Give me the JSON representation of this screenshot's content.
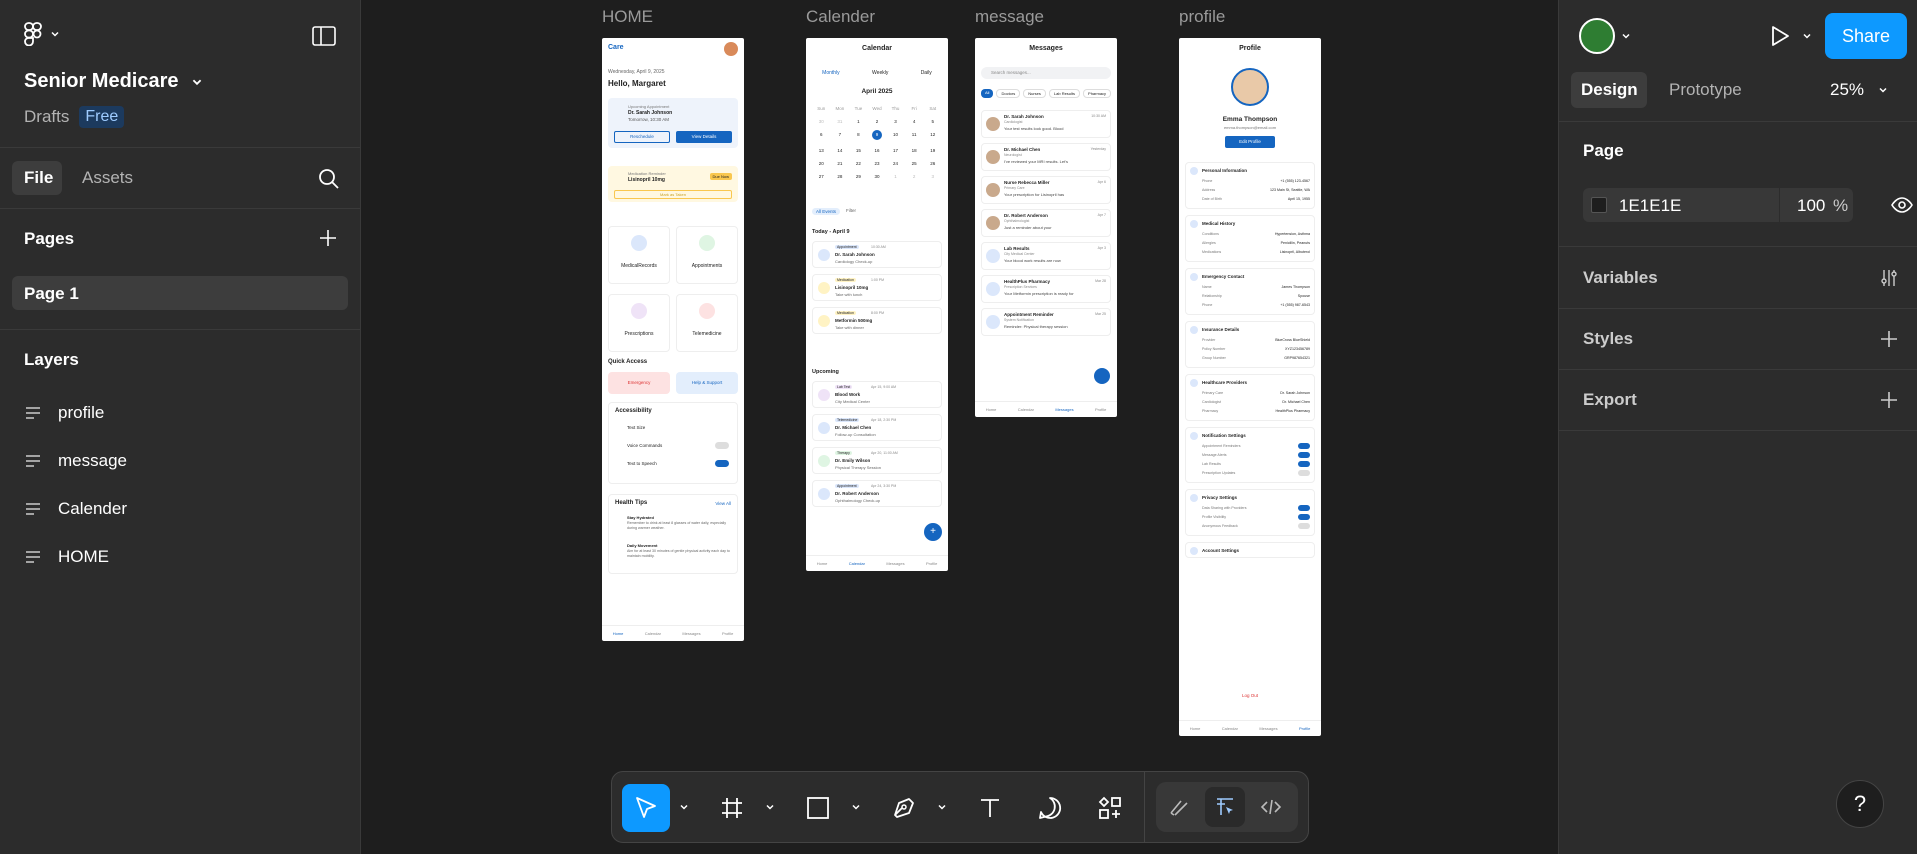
{
  "project": {
    "name": "Senior Medicare",
    "location": "Drafts",
    "plan": "Free"
  },
  "left_tabs": {
    "file": "File",
    "assets": "Assets"
  },
  "pages": {
    "title": "Pages",
    "items": [
      "Page 1"
    ]
  },
  "layers": {
    "title": "Layers",
    "items": [
      "profile",
      "message",
      "Calender",
      "HOME"
    ]
  },
  "frames": [
    {
      "label": "HOME"
    },
    {
      "label": "Calender"
    },
    {
      "label": "message"
    },
    {
      "label": "profile"
    }
  ],
  "home": {
    "logo": "Care",
    "date": "Wednesday, April 9, 2025",
    "greeting": "Hello, Margaret",
    "appt_label": "Upcoming Appointment",
    "appt_doctor": "Dr. Sarah Johnson",
    "appt_time": "Tomorrow, 10:30 AM",
    "reschedule": "Reschedule",
    "view_details": "View Details",
    "med_label": "Medication Reminder",
    "med_name": "Lisinopril 10mg",
    "due_now": "Due Now",
    "mark_taken": "Mark as Taken",
    "tiles": [
      "MedicalRecords",
      "Appointments",
      "Prescriptions",
      "Telemedicine"
    ],
    "quick_access": "Quick Access",
    "emergency": "Emergency",
    "help": "Help & Support",
    "accessibility": "Accessibility",
    "acc_items": [
      "Text Size",
      "Voice Commands",
      "Text to Speech"
    ],
    "health_tips": "Health Tips",
    "view_all": "View All",
    "tip1_title": "Stay Hydrated",
    "tip1_body": "Remember to drink at least 8 glasses of water daily, especially during warmer weather.",
    "tip2_title": "Daily Movement",
    "tip2_body": "Aim for at least 30 minutes of gentle physical activity each day to maintain mobility.",
    "nav": [
      "Home",
      "Calendar",
      "Messages",
      "Profile"
    ]
  },
  "calendar": {
    "title": "Calendar",
    "views": [
      "Monthly",
      "Weekly",
      "Daily"
    ],
    "month": "April 2025",
    "weekdays": [
      "Sun",
      "Mon",
      "Tue",
      "Wed",
      "Thu",
      "Fri",
      "Sat"
    ],
    "days": [
      "30",
      "31",
      "1",
      "2",
      "3",
      "4",
      "5",
      "6",
      "7",
      "8",
      "9",
      "10",
      "11",
      "12",
      "13",
      "14",
      "15",
      "16",
      "17",
      "18",
      "19",
      "20",
      "21",
      "22",
      "23",
      "24",
      "25",
      "26",
      "27",
      "28",
      "29",
      "30",
      "1",
      "2",
      "3"
    ],
    "filters": [
      "All Events",
      "Filter"
    ],
    "today": "Today - April 9",
    "today_items": [
      {
        "tag": "Appointment",
        "time": "10:30 AM",
        "title": "Dr. Sarah Johnson",
        "sub": "Cardiology Check-up"
      },
      {
        "tag": "Medication",
        "time": "1:00 PM",
        "title": "Lisinopril 10mg",
        "sub": "Take with lunch"
      },
      {
        "tag": "Medication",
        "time": "8:00 PM",
        "title": "Metformin 500mg",
        "sub": "Take with dinner"
      }
    ],
    "upcoming": "Upcoming",
    "upcoming_items": [
      {
        "tag": "Lab Test",
        "time": "Apr 15, 9:00 AM",
        "title": "Blood Work",
        "sub": "City Medical Center"
      },
      {
        "tag": "Telemedicine",
        "time": "Apr 18, 2:30 PM",
        "title": "Dr. Michael Chen",
        "sub": "Follow-up Consultation"
      },
      {
        "tag": "Therapy",
        "time": "Apr 20, 11:00 AM",
        "title": "Dr. Emily Wilson",
        "sub": "Physical Therapy Session"
      },
      {
        "tag": "Appointment",
        "time": "Apr 24, 3:30 PM",
        "title": "Dr. Robert Anderson",
        "sub": "Ophthalmology Check-up"
      }
    ],
    "nav": [
      "Home",
      "Calendar",
      "Messages",
      "Profile"
    ]
  },
  "messages": {
    "title": "Messages",
    "search": "Search messages...",
    "chips": [
      "All",
      "Doctors",
      "Nurses",
      "Lab Results",
      "Pharmacy"
    ],
    "items": [
      {
        "name": "Dr. Sarah Johnson",
        "role": "Cardiologist",
        "time": "10:30 AM",
        "text": "Your test results look good. Blood"
      },
      {
        "name": "Dr. Michael Chen",
        "role": "Neurologist",
        "time": "Yesterday",
        "text": "I've reviewed your MRI results. Let's"
      },
      {
        "name": "Nurse Rebecca Miller",
        "role": "Primary Care",
        "time": "Apr 6",
        "text": "Your prescription for Lisinopril has"
      },
      {
        "name": "Dr. Robert Anderson",
        "role": "Ophthalmologist",
        "time": "Apr 7",
        "text": "Just a reminder about your"
      },
      {
        "name": "Lab Results",
        "role": "City Medical Center",
        "time": "Apr 3",
        "text": "Your blood work results are now"
      },
      {
        "name": "HealthPlus Pharmacy",
        "role": "Prescription Services",
        "time": "Mar 28",
        "text": "Your Metformin prescription is ready for"
      },
      {
        "name": "Appointment Reminder",
        "role": "System Notification",
        "time": "Mar 25",
        "text": "Reminder: Physical therapy session"
      }
    ],
    "nav": [
      "Home",
      "Calendar",
      "Messages",
      "Profile"
    ]
  },
  "profile": {
    "title": "Profile",
    "name": "Emma Thompson",
    "email": "emma.thompson@email.com",
    "edit": "Edit Profile",
    "sections": [
      {
        "title": "Personal Information",
        "rows": [
          [
            "Phone",
            "+1 (555) 123-4567"
          ],
          [
            "Address",
            "123 Main St, Seattle, WA"
          ],
          [
            "Date of Birth",
            "April 15, 1955"
          ]
        ]
      },
      {
        "title": "Medical History",
        "rows": [
          [
            "Conditions",
            "Hypertension, Asthma"
          ],
          [
            "Allergies",
            "Penicillin, Peanuts"
          ],
          [
            "Medications",
            "Lisinopril, Albuterol"
          ]
        ]
      },
      {
        "title": "Emergency Contact",
        "rows": [
          [
            "Name",
            "James Thompson"
          ],
          [
            "Relationship",
            "Spouse"
          ],
          [
            "Phone",
            "+1 (555) 987-6543"
          ]
        ]
      },
      {
        "title": "Insurance Details",
        "rows": [
          [
            "Provider",
            "BlueCross BlueShield"
          ],
          [
            "Policy Number",
            "XYZ123456789"
          ],
          [
            "Group Number",
            "GRP987654321"
          ]
        ]
      },
      {
        "title": "Healthcare Providers",
        "rows": [
          [
            "Primary Care",
            "Dr. Sarah Johnson"
          ],
          [
            "Cardiologist",
            "Dr. Michael Chen"
          ],
          [
            "Pharmacy",
            "HealthPlus Pharmacy"
          ]
        ]
      },
      {
        "title": "Notification Settings",
        "rows": [
          [
            "Appointment Reminders",
            ""
          ],
          [
            "Message Alerts",
            ""
          ],
          [
            "Lab Results",
            ""
          ],
          [
            "Prescription Updates",
            ""
          ]
        ]
      },
      {
        "title": "Privacy Settings",
        "rows": [
          [
            "Data Sharing with Providers",
            ""
          ],
          [
            "Profile Visibility",
            ""
          ],
          [
            "Anonymous Feedback",
            ""
          ]
        ]
      },
      {
        "title": "Account Settings",
        "rows": []
      }
    ],
    "logout": "Log Out",
    "nav": [
      "Home",
      "Calendar",
      "Messages",
      "Profile"
    ]
  },
  "toolbar": {
    "tools": [
      "move-tool",
      "frame-tool",
      "rectangle-tool",
      "pen-tool",
      "text-tool",
      "comment-tool",
      "actions-tool",
      "draw-mode",
      "design-mode",
      "dev-mode"
    ]
  },
  "right": {
    "play": "",
    "share": "Share",
    "tabs": {
      "design": "Design",
      "prototype": "Prototype"
    },
    "zoom": "25%",
    "page_title": "Page",
    "bg_hex": "1E1E1E",
    "bg_opacity": "100",
    "percent": "%",
    "variables": "Variables",
    "styles": "Styles",
    "export": "Export"
  },
  "help": "?",
  "colors": {
    "accent": "#0d99ff",
    "panel": "#2c2c2c",
    "canvas": "#1e1e1e",
    "app_blue": "#1565c0"
  }
}
